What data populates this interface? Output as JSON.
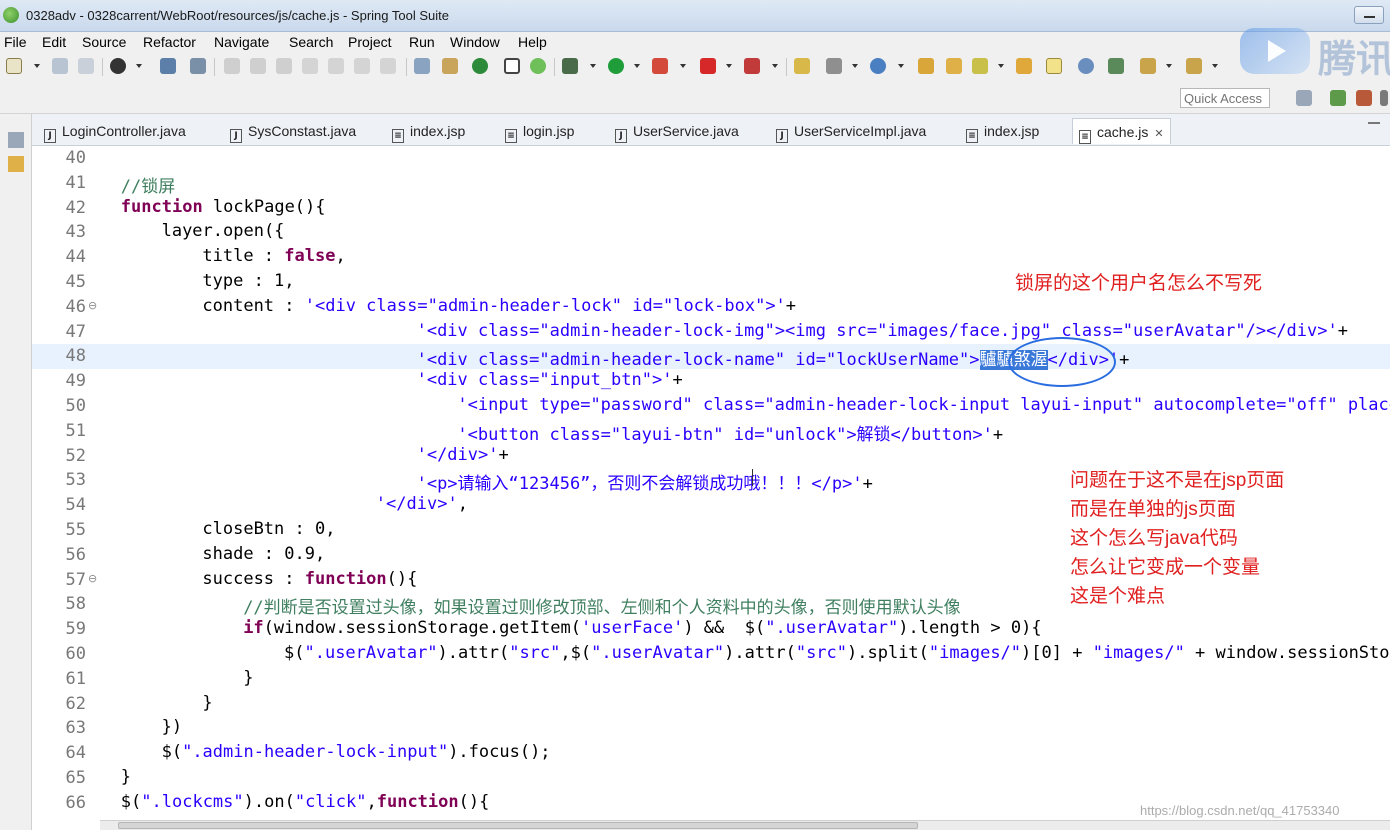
{
  "window": {
    "title": "0328adv - 0328carrent/WebRoot/resources/js/cache.js - Spring Tool Suite"
  },
  "menu": [
    "File",
    "Edit",
    "Source",
    "Refactor",
    "Navigate",
    "Search",
    "Project",
    "Run",
    "Window",
    "Help"
  ],
  "watermark": "腾讯",
  "quick_access": {
    "placeholder": "Quick Access"
  },
  "tabs": [
    {
      "label": "LoginController.java",
      "type": "java"
    },
    {
      "label": "SysConstast.java",
      "type": "java"
    },
    {
      "label": "index.jsp",
      "type": "jsp"
    },
    {
      "label": "login.jsp",
      "type": "jsp"
    },
    {
      "label": "UserService.java",
      "type": "java"
    },
    {
      "label": "UserServiceImpl.java",
      "type": "java"
    },
    {
      "label": "index.jsp",
      "type": "jsp"
    },
    {
      "label": "cache.js",
      "type": "js",
      "active": true
    }
  ],
  "editor": {
    "current_line": 48,
    "lines": [
      {
        "n": "40",
        "indent": 0,
        "segs": []
      },
      {
        "n": "41",
        "indent": 4,
        "segs": [
          [
            "cmt",
            "//锁屏"
          ]
        ]
      },
      {
        "n": "42",
        "indent": 4,
        "segs": [
          [
            "kw",
            "function"
          ],
          [
            "",
            " lockPage(){"
          ]
        ]
      },
      {
        "n": "43",
        "indent": 8,
        "segs": [
          [
            "",
            "layer.open({"
          ]
        ]
      },
      {
        "n": "44",
        "indent": 12,
        "segs": [
          [
            "",
            "title : "
          ],
          [
            "kw",
            "false"
          ],
          [
            "",
            ","
          ]
        ]
      },
      {
        "n": "45",
        "indent": 12,
        "segs": [
          [
            "",
            "type : 1,"
          ]
        ]
      },
      {
        "n": "46",
        "indent": 12,
        "fold": true,
        "segs": [
          [
            "",
            "content : "
          ],
          [
            "str",
            "'<div class=\"admin-header-lock\" id=\"lock-box\">'"
          ],
          [
            "",
            "+"
          ]
        ]
      },
      {
        "n": "47",
        "indent": 33,
        "segs": [
          [
            "str",
            "'<div class=\"admin-header-lock-img\"><img src=\"images/face.jpg\" class=\"userAvatar\"/></div>'"
          ],
          [
            "",
            "+"
          ]
        ]
      },
      {
        "n": "48",
        "indent": 33,
        "segs": [
          [
            "str",
            "'<div class=\"admin-header-lock-name\" id=\"lockUserName\">"
          ],
          [
            "sel",
            "驢驢煞渥"
          ],
          [
            "str",
            "</div>'"
          ],
          [
            "",
            "+"
          ]
        ]
      },
      {
        "n": "49",
        "indent": 33,
        "segs": [
          [
            "str",
            "'<div class=\"input_btn\">'"
          ],
          [
            "",
            "+"
          ]
        ]
      },
      {
        "n": "50",
        "indent": 37,
        "segs": [
          [
            "str",
            "'<input type=\"password\" class=\"admin-header-lock-input layui-input\" autocomplete=\"off\" placeholder=\"\"/>'"
          ],
          [
            "",
            "+"
          ]
        ]
      },
      {
        "n": "51",
        "indent": 37,
        "segs": [
          [
            "str",
            "'<button class=\"layui-btn\" id=\"unlock\">解锁</button>'"
          ],
          [
            "",
            "+"
          ]
        ]
      },
      {
        "n": "52",
        "indent": 33,
        "segs": [
          [
            "str",
            "'</div>'"
          ],
          [
            "",
            "+"
          ]
        ]
      },
      {
        "n": "53",
        "indent": 33,
        "segs": [
          [
            "str",
            "'<p>请输入“123456”，否则不会解锁成功哦！！！</p>'"
          ],
          [
            "",
            "+"
          ]
        ]
      },
      {
        "n": "54",
        "indent": 29,
        "segs": [
          [
            "str",
            "'</div>'"
          ],
          [
            "",
            ","
          ]
        ]
      },
      {
        "n": "55",
        "indent": 12,
        "segs": [
          [
            "",
            "closeBtn : 0,"
          ]
        ]
      },
      {
        "n": "56",
        "indent": 12,
        "segs": [
          [
            "",
            "shade : 0.9,"
          ]
        ]
      },
      {
        "n": "57",
        "indent": 12,
        "fold": true,
        "segs": [
          [
            "",
            "success : "
          ],
          [
            "kw",
            "function"
          ],
          [
            "",
            "(){"
          ]
        ]
      },
      {
        "n": "58",
        "indent": 16,
        "segs": [
          [
            "cmt",
            "//判断是否设置过头像，如果设置过则修改顶部、左侧和个人资料中的头像，否则使用默认头像"
          ]
        ]
      },
      {
        "n": "59",
        "indent": 16,
        "segs": [
          [
            "kw",
            "if"
          ],
          [
            "",
            "(window.sessionStorage.getItem("
          ],
          [
            "str",
            "'userFace'"
          ],
          [
            "",
            ") &&  $("
          ],
          [
            "str",
            "\".userAvatar\""
          ],
          [
            "",
            ").length > 0){"
          ]
        ]
      },
      {
        "n": "60",
        "indent": 20,
        "segs": [
          [
            "",
            "$("
          ],
          [
            "str",
            "\".userAvatar\""
          ],
          [
            "",
            ").attr("
          ],
          [
            "str",
            "\"src\""
          ],
          [
            "",
            ",$("
          ],
          [
            "str",
            "\".userAvatar\""
          ],
          [
            "",
            ").attr("
          ],
          [
            "str",
            "\"src\""
          ],
          [
            "",
            ").split("
          ],
          [
            "str",
            "\"images/\""
          ],
          [
            "",
            ")[0] + "
          ],
          [
            "str",
            "\"images/\""
          ],
          [
            "",
            " + window.sessionStorage.getItem('userFace'));"
          ]
        ]
      },
      {
        "n": "61",
        "indent": 16,
        "segs": [
          [
            "",
            "}"
          ]
        ]
      },
      {
        "n": "62",
        "indent": 12,
        "segs": [
          [
            "",
            "}"
          ]
        ]
      },
      {
        "n": "63",
        "indent": 8,
        "segs": [
          [
            "",
            "})"
          ]
        ]
      },
      {
        "n": "64",
        "indent": 8,
        "segs": [
          [
            "",
            "$("
          ],
          [
            "str",
            "\".admin-header-lock-input\""
          ],
          [
            "",
            ").focus();"
          ]
        ]
      },
      {
        "n": "65",
        "indent": 4,
        "segs": [
          [
            "",
            "}"
          ]
        ]
      },
      {
        "n": "66",
        "indent": 4,
        "segs": [
          [
            "",
            "$("
          ],
          [
            "str",
            "\".lockcms\""
          ],
          [
            "",
            ").on("
          ],
          [
            "str",
            "\"click\""
          ],
          [
            "",
            ","
          ],
          [
            "kw",
            "function"
          ],
          [
            "",
            "(){"
          ]
        ]
      }
    ]
  },
  "annotations": {
    "note_top": "锁屏的这个用户名怎么不写死",
    "note_lines": [
      "问题在于这不是在jsp页面",
      "而是在单独的js页面",
      "这个怎么写java代码",
      "怎么让它变成一个变量",
      "这是个难点"
    ]
  },
  "footer": {
    "csdn_watermark": "https://blog.csdn.net/qq_41753340"
  }
}
